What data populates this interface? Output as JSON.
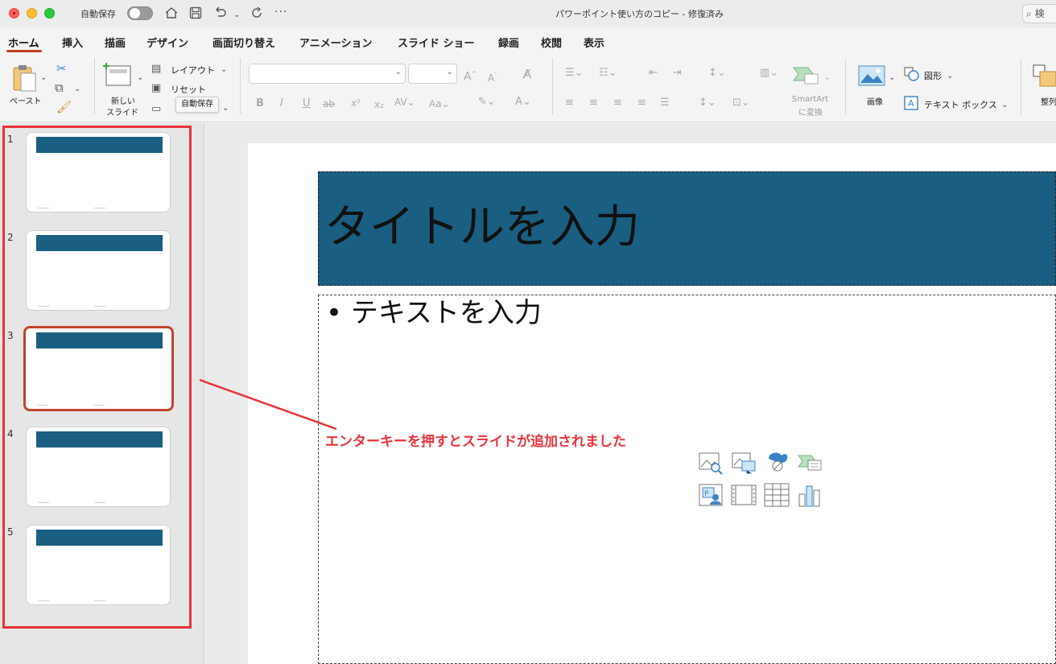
{
  "titlebar": {
    "autosave_label": "自動保存",
    "document_title": "パワーポイント使い方のコピー - 修復済み",
    "search_placeholder": "検"
  },
  "tabs": [
    {
      "label": "ホーム",
      "active": true
    },
    {
      "label": "挿入"
    },
    {
      "label": "描画"
    },
    {
      "label": "デザイン"
    },
    {
      "label": "画面切り替え"
    },
    {
      "label": "アニメーション"
    },
    {
      "label": "スライド ショー"
    },
    {
      "label": "録画"
    },
    {
      "label": "校閲"
    },
    {
      "label": "表示"
    }
  ],
  "ribbon": {
    "paste": "ペースト",
    "new_slide_line1": "新しい",
    "new_slide_line2": "スライド",
    "layout": "レイアウト",
    "reset": "リセット",
    "tooltip": "自動保存",
    "smartart_line1": "SmartArt",
    "smartart_line2": "に変換",
    "image": "画像",
    "shapes": "図形",
    "textbox": "テキスト ボックス",
    "arrange": "整列"
  },
  "slides": [
    {
      "number": "1"
    },
    {
      "number": "2"
    },
    {
      "number": "3",
      "selected": true
    },
    {
      "number": "4"
    },
    {
      "number": "5"
    }
  ],
  "slide": {
    "title_placeholder": "タイトルを入力",
    "body_placeholder": "テキストを入力"
  },
  "annotation": {
    "text": "エンターキーを押すとスライドが追加されました",
    "color": "#e8333a"
  },
  "colors": {
    "accent_tab": "#c43e1c",
    "title_bar": "#1a5e82",
    "selection": "#c0442a"
  }
}
